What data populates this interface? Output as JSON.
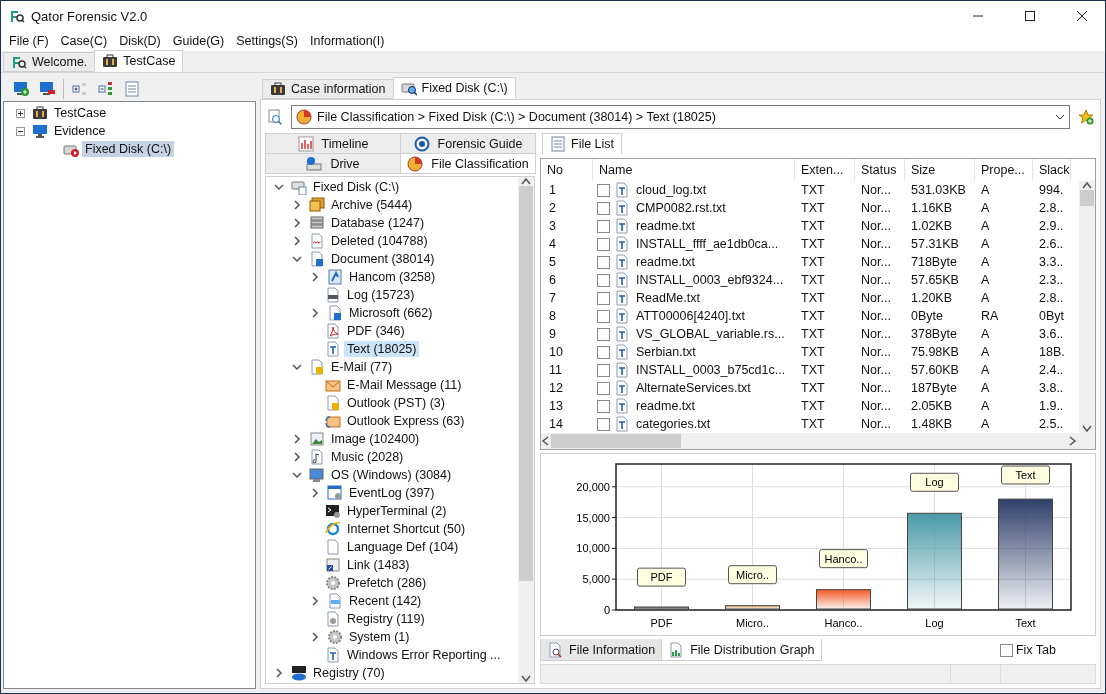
{
  "window": {
    "title": "Qator Forensic V2.0"
  },
  "menu": [
    "File (F)",
    "Case(C)",
    "Disk(D)",
    "Guide(G)",
    "Settings(S)",
    "Information(I)"
  ],
  "doc_tabs": [
    {
      "label": "Welcome.",
      "kind": "logo",
      "selected": false
    },
    {
      "label": "TestCase",
      "kind": "case",
      "selected": true
    }
  ],
  "case_tree": [
    {
      "label": "TestCase",
      "kind": "case",
      "expanded": false,
      "selected": false
    },
    {
      "label": "Evidence",
      "kind": "monitor",
      "expanded": true,
      "selected": false,
      "children": [
        {
          "label": "Fixed Disk (C:\\)",
          "kind": "evidence",
          "selected": true
        }
      ]
    }
  ],
  "view_tabs": [
    {
      "label": "Case information",
      "kind": "case",
      "selected": false
    },
    {
      "label": "Fixed Disk (C:\\)",
      "kind": "diskview",
      "selected": true
    }
  ],
  "breadcrumb": "File Classification > Fixed Disk (C:\\) > Document (38014) > Text (18025)",
  "nav_tab_rows": [
    {
      "tabs": [
        {
          "label": "Timeline",
          "kind": "timeline",
          "selected": false
        },
        {
          "label": "Forensic Guide",
          "kind": "guide",
          "selected": false
        }
      ]
    },
    {
      "tabs": [
        {
          "label": "Drive",
          "kind": "drive",
          "selected": false
        },
        {
          "label": "File Classification",
          "kind": "pie",
          "selected": true
        }
      ]
    }
  ],
  "class_tree": [
    {
      "label": "Fixed Disk (C:\\)",
      "kind": "disk",
      "expanded": true,
      "selected": false,
      "children": [
        {
          "label": "Archive (5444)",
          "kind": "archive",
          "expanded": false,
          "selected": false
        },
        {
          "label": "Database (1247)",
          "kind": "database",
          "expanded": false,
          "selected": false
        },
        {
          "label": "Deleted (104788)",
          "kind": "deleted",
          "expanded": false,
          "selected": false
        },
        {
          "label": "Document (38014)",
          "kind": "word",
          "expanded": true,
          "selected": false,
          "children": [
            {
              "label": "Hancom (3258)",
              "kind": "hancom",
              "expanded": false,
              "selected": false
            },
            {
              "label": "Log (15723)",
              "kind": "log",
              "selected": false
            },
            {
              "label": "Microsoft (662)",
              "kind": "word",
              "expanded": false,
              "selected": false
            },
            {
              "label": "PDF (346)",
              "kind": "pdf",
              "selected": false
            },
            {
              "label": "Text (18025)",
              "kind": "text",
              "selected": true
            }
          ]
        },
        {
          "label": "E-Mail (77)",
          "kind": "maildoc",
          "expanded": true,
          "selected": false,
          "children": [
            {
              "label": "E-Mail Message (11)",
              "kind": "mail",
              "selected": false
            },
            {
              "label": "Outlook (PST) (3)",
              "kind": "maildoc",
              "selected": false
            },
            {
              "label": "Outlook Express (63)",
              "kind": "express",
              "selected": false
            }
          ]
        },
        {
          "label": "Image (102400)",
          "kind": "image",
          "expanded": false,
          "selected": false
        },
        {
          "label": "Music (2028)",
          "kind": "music",
          "expanded": false,
          "selected": false
        },
        {
          "label": "OS (Windows) (3084)",
          "kind": "os",
          "expanded": true,
          "selected": false,
          "children": [
            {
              "label": "EventLog (397)",
              "kind": "eventlog",
              "expanded": false,
              "selected": false
            },
            {
              "label": "HyperTerminal (2)",
              "kind": "terminal",
              "selected": false
            },
            {
              "label": "Internet Shortcut (50)",
              "kind": "globe",
              "selected": false
            },
            {
              "label": "Language Def (104)",
              "kind": "blank",
              "selected": false
            },
            {
              "label": "Link (1483)",
              "kind": "link",
              "selected": false
            },
            {
              "label": "Prefetch (286)",
              "kind": "gear",
              "selected": false
            },
            {
              "label": "Recent (142)",
              "kind": "recent",
              "expanded": false,
              "selected": false
            },
            {
              "label": "Registry (119)",
              "kind": "geardoc",
              "selected": false
            },
            {
              "label": "System (1)",
              "kind": "gear",
              "expanded": false,
              "selected": false
            },
            {
              "label": "Windows Error Reporting ...",
              "kind": "text",
              "selected": false
            }
          ]
        }
      ]
    },
    {
      "label": "Registry (70)",
      "kind": "reg",
      "expanded": false,
      "selected": false
    }
  ],
  "file_list": {
    "tab": "File List",
    "columns": [
      "No",
      "Name",
      "Exten...",
      "Status",
      "Size",
      "Prope...",
      "Slack"
    ],
    "rows": [
      {
        "no": "1",
        "checked": false,
        "name": "cloud_log.txt",
        "ext": "TXT",
        "status": "Nor...",
        "size": "531.03KB",
        "prop": "A",
        "slack": "994."
      },
      {
        "no": "2",
        "checked": false,
        "name": "CMP0082.rst.txt",
        "ext": "TXT",
        "status": "Nor...",
        "size": "1.16KB",
        "prop": "A",
        "slack": "2.8.."
      },
      {
        "no": "3",
        "checked": false,
        "name": "readme.txt",
        "ext": "TXT",
        "status": "Nor...",
        "size": "1.02KB",
        "prop": "A",
        "slack": "2.9.."
      },
      {
        "no": "4",
        "checked": false,
        "name": "INSTALL_ffff_ae1db0ca...",
        "ext": "TXT",
        "status": "Nor...",
        "size": "57.31KB",
        "prop": "A",
        "slack": "2.6.."
      },
      {
        "no": "5",
        "checked": false,
        "name": "readme.txt",
        "ext": "TXT",
        "status": "Nor...",
        "size": "718Byte",
        "prop": "A",
        "slack": "3.3.."
      },
      {
        "no": "6",
        "checked": false,
        "name": "INSTALL_0003_ebf9324...",
        "ext": "TXT",
        "status": "Nor...",
        "size": "57.65KB",
        "prop": "A",
        "slack": "2.3.."
      },
      {
        "no": "7",
        "checked": false,
        "name": "ReadMe.txt",
        "ext": "TXT",
        "status": "Nor...",
        "size": "1.20KB",
        "prop": "A",
        "slack": "2.8.."
      },
      {
        "no": "8",
        "checked": false,
        "name": "ATT00006[4240].txt",
        "ext": "TXT",
        "status": "Nor...",
        "size": "0Byte",
        "prop": "RA",
        "slack": "0Byt"
      },
      {
        "no": "9",
        "checked": false,
        "name": "VS_GLOBAL_variable.rs...",
        "ext": "TXT",
        "status": "Nor...",
        "size": "378Byte",
        "prop": "A",
        "slack": "3.6.."
      },
      {
        "no": "10",
        "checked": false,
        "name": "Serbian.txt",
        "ext": "TXT",
        "status": "Nor...",
        "size": "75.98KB",
        "prop": "A",
        "slack": "18B."
      },
      {
        "no": "11",
        "checked": false,
        "name": "INSTALL_0003_b75cd1c...",
        "ext": "TXT",
        "status": "Nor...",
        "size": "57.60KB",
        "prop": "A",
        "slack": "2.4.."
      },
      {
        "no": "12",
        "checked": false,
        "name": "AlternateServices.txt",
        "ext": "TXT",
        "status": "Nor...",
        "size": "187Byte",
        "prop": "A",
        "slack": "3.8.."
      },
      {
        "no": "13",
        "checked": false,
        "name": "readme.txt",
        "ext": "TXT",
        "status": "Nor...",
        "size": "2.05KB",
        "prop": "A",
        "slack": "1.9.."
      },
      {
        "no": "14",
        "checked": false,
        "name": "categories.txt",
        "ext": "TXT",
        "status": "Nor...",
        "size": "1.48KB",
        "prop": "A",
        "slack": "2.5.."
      }
    ]
  },
  "graph": {
    "chart_data": {
      "type": "bar",
      "categories": [
        "PDF",
        "Micro..",
        "Hanco..",
        "Log",
        "Text"
      ],
      "values": [
        300,
        700,
        3300,
        15700,
        18000
      ],
      "grid": true,
      "ylim": [
        0,
        23700
      ],
      "yticks": [
        {
          "value": 0,
          "label": "0"
        },
        {
          "value": 5000,
          "label": "5,000"
        },
        {
          "value": 10000,
          "label": "10,000"
        },
        {
          "value": 15000,
          "label": "15,000"
        },
        {
          "value": 20000,
          "label": "20,000"
        }
      ],
      "annotations": [
        "PDF",
        "Micro..",
        "Hanco..",
        "Log",
        "Text"
      ]
    }
  },
  "bottom_tabs": [
    {
      "label": "File Information",
      "kind": "filesearch",
      "selected": false
    },
    {
      "label": "File Distribution Graph",
      "kind": "graph",
      "selected": true
    }
  ],
  "fix_tab": {
    "label": "Fix Tab",
    "checked": false
  }
}
